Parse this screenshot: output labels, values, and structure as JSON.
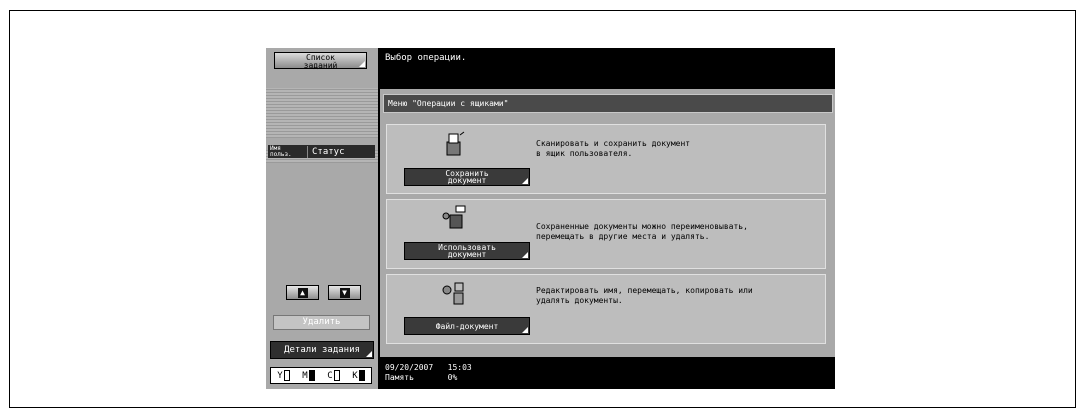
{
  "left_panel": {
    "job_list_button": [
      "Список",
      "заданий"
    ],
    "user_col": [
      "Имя",
      "польз."
    ],
    "status_col": "Статус",
    "delete_button": "Удалить",
    "job_details_button": "Детали задания",
    "toner": [
      {
        "label": "Y",
        "filled": false
      },
      {
        "label": "M",
        "filled": true
      },
      {
        "label": "C",
        "filled": false
      },
      {
        "label": "K",
        "filled": true
      }
    ]
  },
  "header": {
    "message": "Выбор операции."
  },
  "menu": {
    "title": "Меню \"Операции с ящиками\"",
    "items": [
      {
        "button_line1": "Сохранить",
        "button_line2": "документ",
        "description": "Сканировать и сохранить документ\nв ящик пользователя.",
        "icon": "save-document-icon"
      },
      {
        "button_line1": "Использовать",
        "button_line2": "документ",
        "description": "Сохраненные документы можно переименовывать,\nперемещать в другие места и удалять.",
        "icon": "use-document-icon"
      },
      {
        "button_line1": "Файл-документ",
        "button_line2": "",
        "description": "Редактировать имя, перемещать, копировать или\nудалять документы.",
        "icon": "file-document-icon"
      }
    ]
  },
  "status_bar": {
    "date": "09/20/2007",
    "time": "15:03",
    "memory_label": "Память",
    "memory_value": "0%"
  }
}
